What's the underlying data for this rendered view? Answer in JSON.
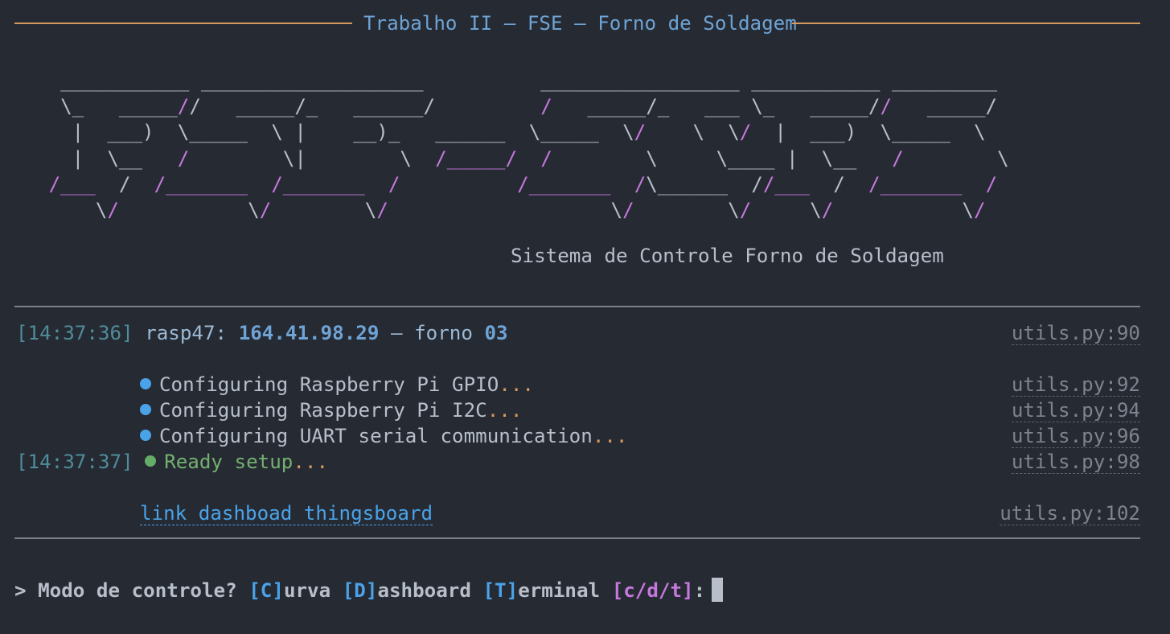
{
  "header": {
    "title": "Trabalho II – FSE – Forno de Soldagem"
  },
  "banner": {
    "ascii_art_lines": [
      "___________ ___________________         _________________ ___________ _________",
      "\\_   _____//   _____/_   ______/        /   _____/_   ___ \\_   _____//   _____/",
      " |  ___)  \\_____  \\ |    __)_   ______  \\_____  \\/    \\  \\/  |  ___)  \\_____  \\",
      " |  \\__   /        \\|        \\  /_____/  /        \\     \\____ |  \\__   /        \\",
      "/___  /  /_______  /_______  /          /_______  /\\______  //___  /  /_______  /",
      "    \\/           \\/        \\/                   \\/        \\/     \\/           \\/"
    ],
    "subtitle": "Sistema de Controle Forno de Soldagem"
  },
  "log": {
    "connection": {
      "timestamp": "[14:37:36]",
      "host_label": "rasp47:",
      "ip": "164.41.98.29",
      "separator": "–",
      "forno_label": "forno",
      "forno_number": "03",
      "source": "utils.py:90"
    },
    "steps": [
      {
        "text": "Configuring Raspberry Pi GPIO",
        "ellipsis": "...",
        "source": "utils.py:92",
        "color": "#4aa3e9"
      },
      {
        "text": "Configuring Raspberry Pi I2C",
        "ellipsis": "...",
        "source": "utils.py:94",
        "color": "#4aa3e9"
      },
      {
        "text": "Configuring UART serial communication",
        "ellipsis": "...",
        "source": "utils.py:96",
        "color": "#4aa3e9"
      }
    ],
    "ready": {
      "timestamp": "[14:37:37]",
      "text": "Ready setup",
      "ellipsis": "...",
      "source": "utils.py:98",
      "color": "#64ad68"
    },
    "dashboard_link": {
      "text": "link dashboad thingsboard",
      "source": "utils.py:102"
    }
  },
  "prompt": {
    "symbol": ">",
    "question": "Modo de controle?",
    "option_c_key": "[C]",
    "option_c_rest": "urva",
    "option_d_key": "[D]",
    "option_d_rest": "ashboard",
    "option_t_key": "[T]",
    "option_t_rest": "erminal",
    "choices": "[c/d/t]",
    "suffix": ":"
  },
  "colors": {
    "background": "#262a33",
    "accent_blue": "#4aa3e9",
    "accent_magenta": "#c678dd",
    "accent_orange": "#d49a5e",
    "success_green": "#64ad68"
  }
}
